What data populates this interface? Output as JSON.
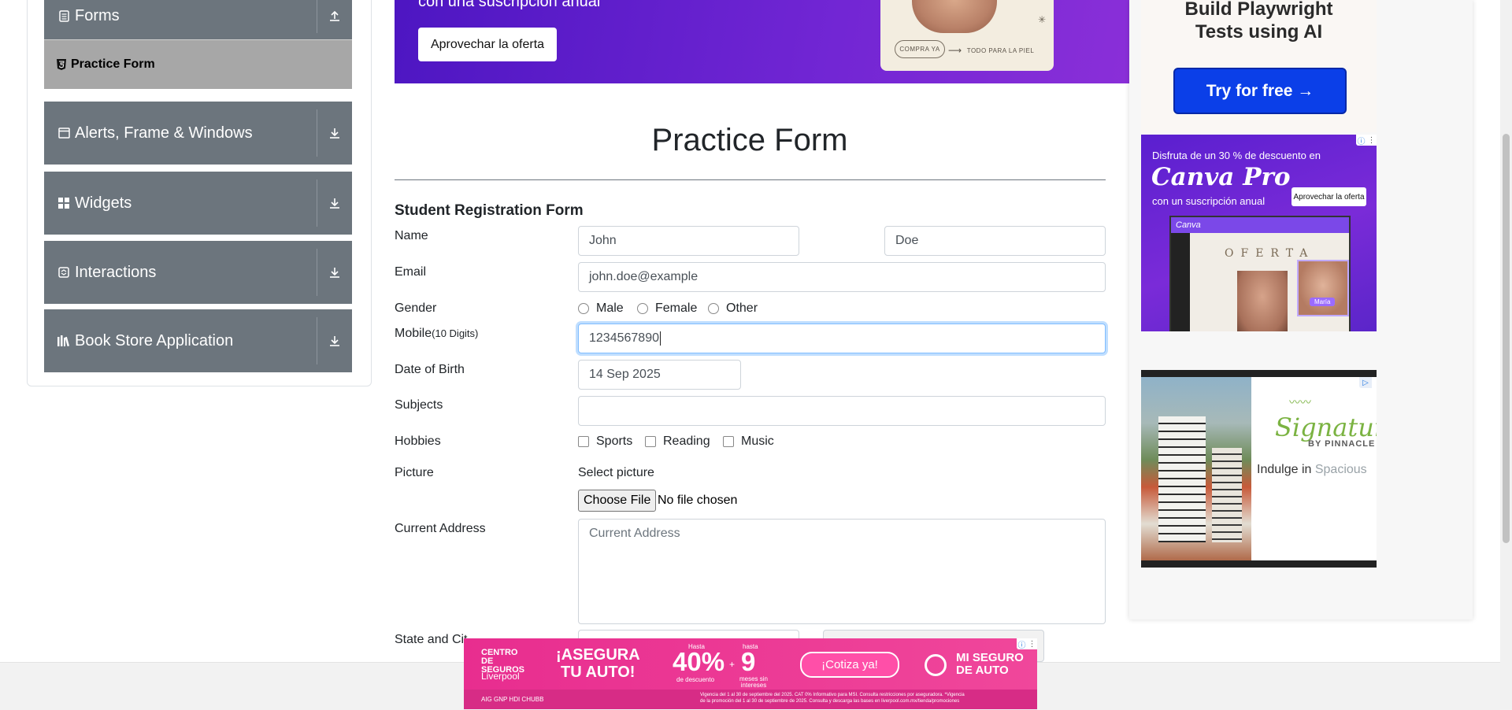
{
  "sidebar": {
    "forms_label": "Forms",
    "practice_form_label": "Practice Form",
    "groups": [
      {
        "label": "Alerts, Frame & Windows"
      },
      {
        "label": "Widgets"
      },
      {
        "label": "Interactions"
      },
      {
        "label": "Book Store Application"
      }
    ]
  },
  "top_banner": {
    "subtitle": "con una suscripción anual",
    "button": "Aprovechar la oferta",
    "pill": "COMPRA YA",
    "tagline": "TODO PARA LA PIEL"
  },
  "form": {
    "title": "Practice Form",
    "subtitle": "Student Registration Form",
    "name_label": "Name",
    "first_name": "John",
    "last_name": "Doe",
    "email_label": "Email",
    "email_value": "john.doe@example",
    "gender_label": "Gender",
    "gender_options": [
      "Male",
      "Female",
      "Other"
    ],
    "mobile_label": "Mobile",
    "mobile_hint": "(10 Digits)",
    "mobile_value": "1234567890",
    "dob_label": "Date of Birth",
    "dob_value": "14 Sep 2025",
    "subjects_label": "Subjects",
    "subjects_value": "",
    "hobbies_label": "Hobbies",
    "hobbies_options": [
      "Sports",
      "Reading",
      "Music"
    ],
    "picture_label": "Picture",
    "select_picture": "Select picture",
    "choose_file": "Choose File",
    "no_file": "No file chosen",
    "address_label": "Current Address",
    "address_placeholder": "Current Address",
    "state_city_label": "State and Cit"
  },
  "ads": {
    "playwright": {
      "line1": "Build Playwright",
      "line2": "Tests using AI",
      "button": "Try for free →"
    },
    "canva": {
      "line1": "Disfruta de un 30 % de descuento en",
      "brand": "Canva Pro",
      "line3": "con un suscripción anual",
      "button": "Aprovechar la oferta",
      "app_label": "Canva",
      "oferta": "OFERTA",
      "tag": "María"
    },
    "signature": {
      "logo": "Signature",
      "by": "BY PINNACLE",
      "text": "Indulge in",
      "text_muted": "Spacious"
    },
    "bottom": {
      "brand1": "CENTRO DE SEGUROS",
      "brand2": "Liverpool",
      "headline1": "¡ASEGURA",
      "headline2": "TU AUTO!",
      "hasta1": "Hasta",
      "pct": "40%",
      "desc": "de descuento",
      "plus": "+",
      "hasta2": "hasta",
      "months": "9",
      "months_text": "meses sin intereses",
      "cta": "¡Cotiza ya!",
      "right1": "MI SEGURO",
      "right2": "DE AUTO",
      "fine1": "Vigencia del 1 al 30 de septiembre del 2025. CAT 0% Informativo para MSI. Consulta restricciones por aseguradora. *Vigencia",
      "fine2": "de la promoción del 1 al 30 de septiembre de 2025. Consulta y descarga las bases en liverpool.com.mx/tienda/promociones",
      "logos": "AIG  GNP  HDI  CHUBB"
    }
  }
}
